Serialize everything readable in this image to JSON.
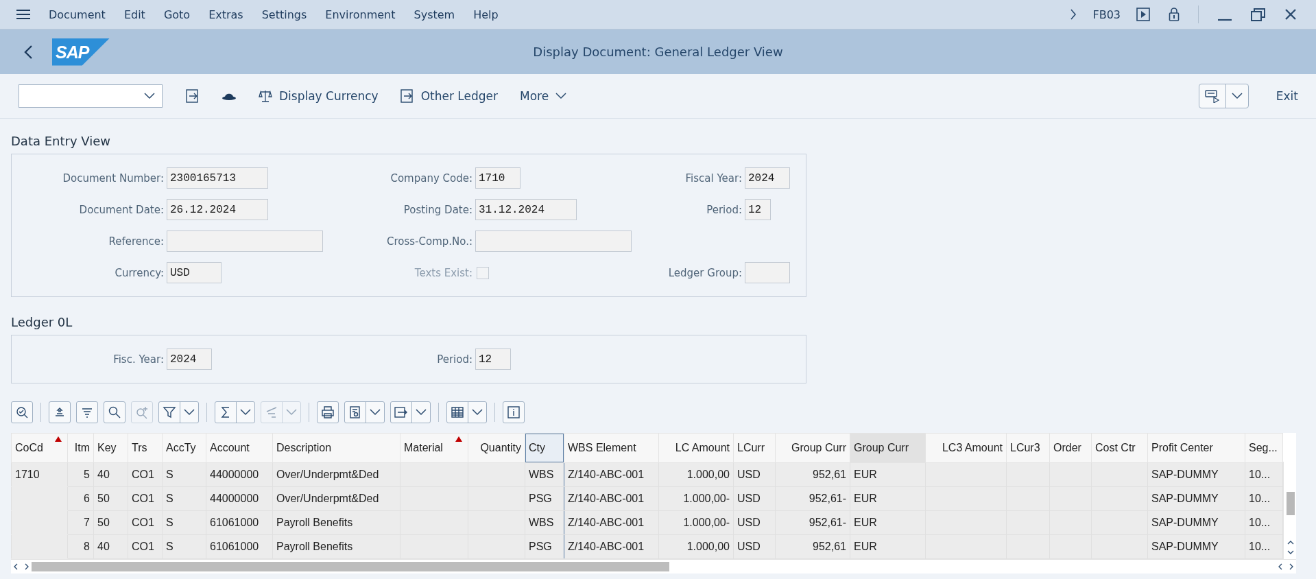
{
  "menu_bar": {
    "items": [
      "Document",
      "Edit",
      "Goto",
      "Extras",
      "Settings",
      "Environment",
      "System",
      "Help"
    ],
    "transaction_code": "FB03"
  },
  "title_bar": {
    "logo": "SAP",
    "title": "Display Document: General Ledger View"
  },
  "toolbar": {
    "items": [
      {
        "kind": "enter"
      },
      {
        "kind": "hat"
      },
      {
        "kind": "scale",
        "label": "Display Currency"
      },
      {
        "kind": "switch",
        "label": "Other Ledger"
      },
      {
        "kind": "menu",
        "label": "More"
      }
    ],
    "exit": "Exit"
  },
  "sections": [
    {
      "title": "Data Entry View",
      "rows": [
        [
          {
            "kind": "text",
            "label": "Document Number:",
            "value": "2300165713"
          },
          {
            "kind": "text",
            "label": "Company Code:",
            "value": "1710"
          },
          {
            "kind": "text",
            "label": "Fiscal Year:",
            "value": "2024"
          }
        ],
        [
          {
            "kind": "text",
            "label": "Document Date:",
            "value": "26.12.2024"
          },
          {
            "kind": "text",
            "label": "Posting Date:",
            "value": "31.12.2024"
          },
          {
            "kind": "text",
            "label": "Period:",
            "value": "12"
          }
        ],
        [
          {
            "kind": "text",
            "label": "Reference:"
          },
          {
            "kind": "text",
            "label": "Cross-Comp.No.:"
          }
        ],
        [
          {
            "kind": "text",
            "label": "Currency:",
            "value": "USD"
          },
          {
            "kind": "checkbox",
            "label": "Texts Exist:",
            "checked": false,
            "disabled": true
          },
          {
            "kind": "text",
            "label": "Ledger Group:"
          }
        ]
      ]
    },
    {
      "title": "Ledger 0L",
      "rows": [
        [
          {
            "kind": "text",
            "label": "Fisc. Year:",
            "value": "2024"
          },
          {
            "kind": "text",
            "label": "Period:",
            "value": "12"
          }
        ]
      ]
    }
  ],
  "table": {
    "toolbar": [
      [
        {
          "kind": "details",
          "dropdown": false,
          "disabled": false
        }
      ],
      [
        {
          "kind": "sort-ascending",
          "dropdown": false,
          "disabled": false
        },
        {
          "kind": "sort-descending",
          "dropdown": false,
          "disabled": false
        },
        {
          "kind": "find",
          "dropdown": false,
          "disabled": false
        },
        {
          "kind": "find-next",
          "dropdown": false,
          "disabled": true
        },
        {
          "kind": "filter",
          "dropdown": true,
          "disabled": false
        }
      ],
      [
        {
          "kind": "sum",
          "dropdown": true,
          "disabled": false
        },
        {
          "kind": "subtotal",
          "dropdown": true,
          "disabled": true
        }
      ],
      [
        {
          "kind": "print",
          "dropdown": false,
          "disabled": false
        },
        {
          "kind": "view",
          "dropdown": true,
          "disabled": false
        },
        {
          "kind": "export",
          "dropdown": true,
          "disabled": false
        }
      ],
      [
        {
          "kind": "layout",
          "dropdown": true,
          "disabled": false
        }
      ],
      [
        {
          "kind": "info",
          "dropdown": false,
          "disabled": false
        }
      ]
    ],
    "columns": [
      {
        "label": "CoCd",
        "marked": true,
        "selected": false,
        "highlighted": false
      },
      {
        "label": "Itm",
        "marked": false,
        "selected": false,
        "highlighted": false
      },
      {
        "label": "Key",
        "marked": false,
        "selected": false,
        "highlighted": false
      },
      {
        "label": "Trs",
        "marked": false,
        "selected": false,
        "highlighted": false
      },
      {
        "label": "AccTy",
        "marked": false,
        "selected": false,
        "highlighted": false
      },
      {
        "label": "Account",
        "marked": false,
        "selected": false,
        "highlighted": false
      },
      {
        "label": "Description",
        "marked": false,
        "selected": false,
        "highlighted": false
      },
      {
        "label": "Material",
        "marked": true,
        "selected": false,
        "highlighted": false
      },
      {
        "label": "Quantity",
        "marked": false,
        "selected": false,
        "highlighted": false
      },
      {
        "label": "Cty",
        "marked": false,
        "selected": true,
        "highlighted": false
      },
      {
        "label": "WBS Element",
        "marked": false,
        "selected": false,
        "highlighted": false
      },
      {
        "label": "LC Amount",
        "marked": false,
        "selected": false,
        "highlighted": false
      },
      {
        "label": "LCurr",
        "marked": false,
        "selected": false,
        "highlighted": false
      },
      {
        "label": "Group Curr",
        "marked": false,
        "selected": false,
        "highlighted": false
      },
      {
        "label": "Group Curr",
        "marked": false,
        "selected": false,
        "highlighted": true
      },
      {
        "label": "LC3 Amount",
        "marked": false,
        "selected": false,
        "highlighted": false
      },
      {
        "label": "LCur3",
        "marked": false,
        "selected": false,
        "highlighted": false
      },
      {
        "label": "Order",
        "marked": false,
        "selected": false,
        "highlighted": false
      },
      {
        "label": "Cost Ctr",
        "marked": false,
        "selected": false,
        "highlighted": false
      },
      {
        "label": "Profit Center",
        "marked": false,
        "selected": false,
        "highlighted": false
      },
      {
        "label": "Seg...",
        "marked": false,
        "selected": false,
        "highlighted": false
      }
    ],
    "rows": [
      {
        "cells": [
          "1710",
          "5",
          "40",
          "CO1",
          "S",
          "44000000",
          "Over/Underpmt&Ded",
          null,
          null,
          "WBS",
          "Z/140-ABC-001",
          "1.000,00",
          "USD",
          "952,61",
          "EUR",
          null,
          null,
          null,
          null,
          "SAP-DUMMY",
          "10..."
        ]
      },
      {
        "cells": [
          "",
          "6",
          "50",
          "CO1",
          "S",
          "44000000",
          "Over/Underpmt&Ded",
          null,
          null,
          "PSG",
          "Z/140-ABC-001",
          "1.000,00-",
          "USD",
          "952,61-",
          "EUR",
          null,
          null,
          null,
          null,
          "SAP-DUMMY",
          "10..."
        ]
      },
      {
        "cells": [
          "",
          "7",
          "50",
          "CO1",
          "S",
          "61061000",
          "Payroll Benefits",
          null,
          null,
          "WBS",
          "Z/140-ABC-001",
          "1.000,00-",
          "USD",
          "952,61-",
          "EUR",
          null,
          null,
          null,
          null,
          "SAP-DUMMY",
          "10..."
        ]
      },
      {
        "cells": [
          "",
          "8",
          "40",
          "CO1",
          "S",
          "61061000",
          "Payroll Benefits",
          null,
          null,
          "PSG",
          "Z/140-ABC-001",
          "1.000,00",
          "USD",
          "952,61",
          "EUR",
          null,
          null,
          null,
          null,
          "SAP-DUMMY",
          "10..."
        ]
      }
    ]
  }
}
